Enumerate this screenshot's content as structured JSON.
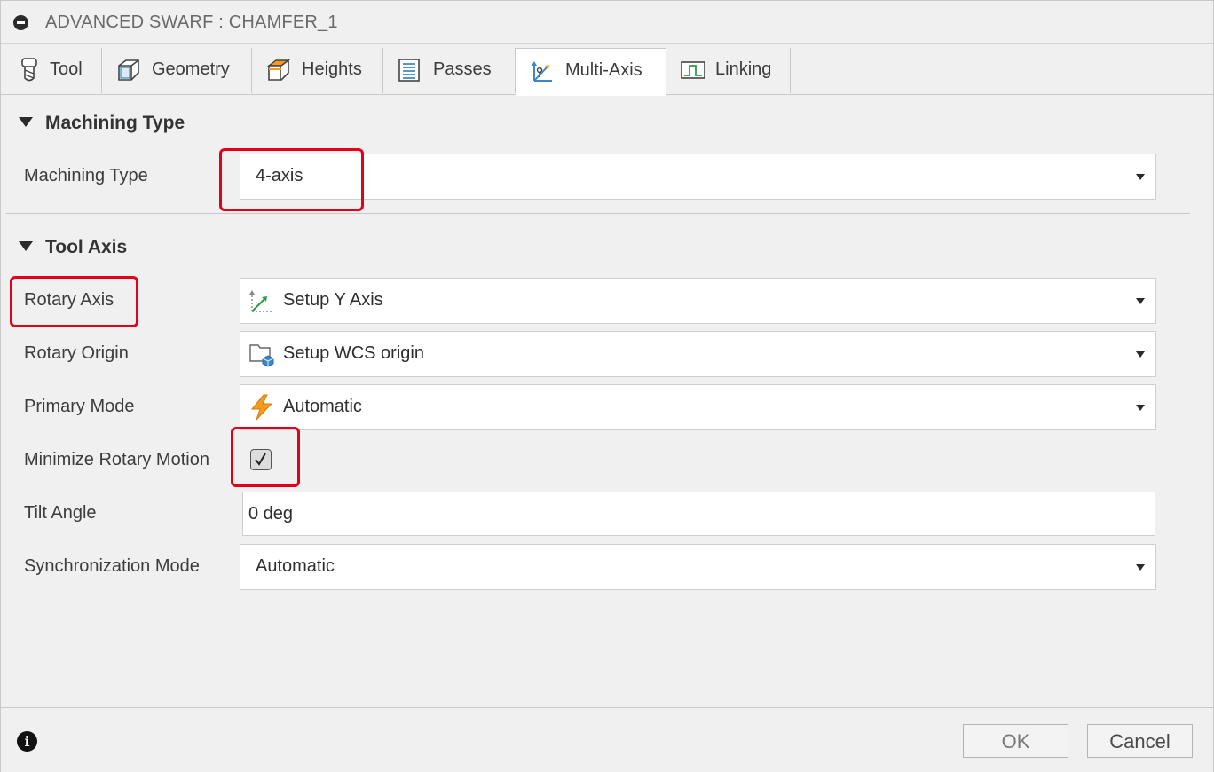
{
  "window": {
    "title": "ADVANCED SWARF : CHAMFER_1"
  },
  "tabs": [
    {
      "label": "Tool",
      "icon": "tool-icon"
    },
    {
      "label": "Geometry",
      "icon": "geometry-icon"
    },
    {
      "label": "Heights",
      "icon": "heights-icon"
    },
    {
      "label": "Passes",
      "icon": "passes-icon"
    },
    {
      "label": "Multi-Axis",
      "icon": "multi-axis-icon",
      "active": true
    },
    {
      "label": "Linking",
      "icon": "linking-icon"
    }
  ],
  "machining_section": {
    "heading": "Machining Type",
    "machining_type_label": "Machining Type",
    "machining_type_value": "4-axis"
  },
  "tool_axis_section": {
    "heading": "Tool Axis",
    "rotary_axis_label": "Rotary Axis",
    "rotary_axis_value": "Setup Y Axis",
    "rotary_origin_label": "Rotary Origin",
    "rotary_origin_value": "Setup WCS origin",
    "primary_mode_label": "Primary Mode",
    "primary_mode_value": "Automatic",
    "minimize_rotary_label": "Minimize Rotary Motion",
    "minimize_rotary_checked": true,
    "tilt_angle_label": "Tilt Angle",
    "tilt_angle_value": "0 deg",
    "sync_mode_label": "Synchronization Mode",
    "sync_mode_value": "Automatic"
  },
  "footer": {
    "ok_label": "OK",
    "cancel_label": "Cancel"
  },
  "colors": {
    "highlight": "#e3001b",
    "accent_orange": "#f59a1b",
    "axis_green": "#2e9e44",
    "icon_blue": "#3e86c6"
  }
}
